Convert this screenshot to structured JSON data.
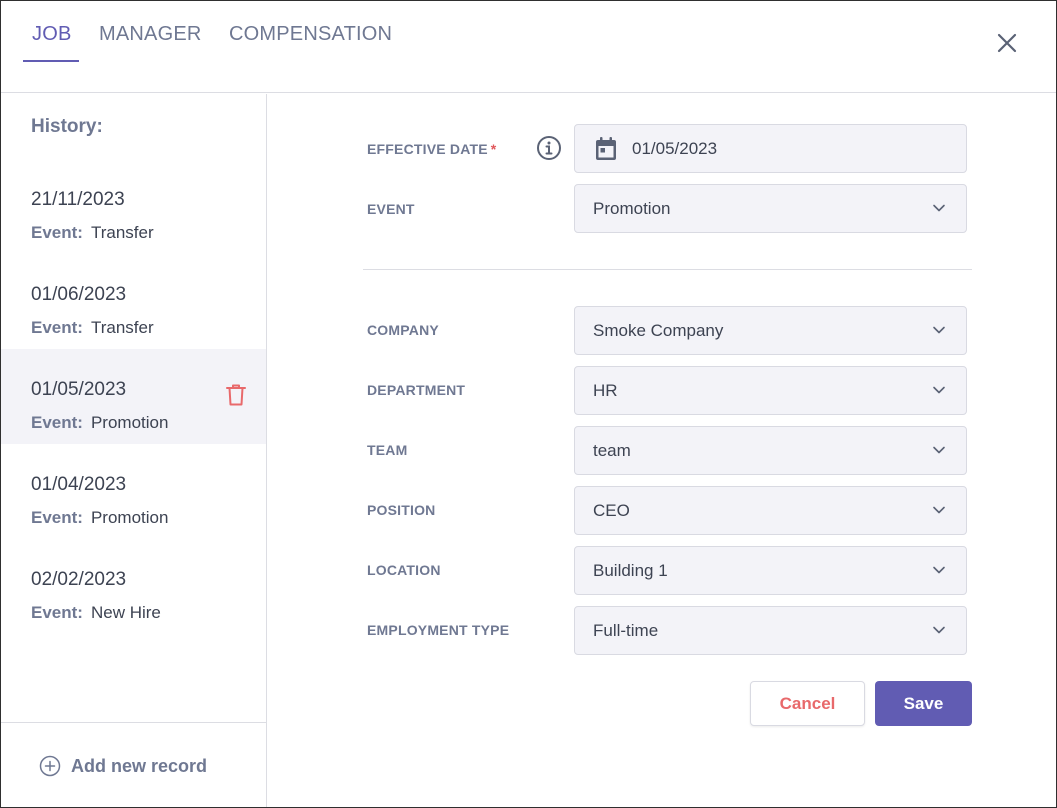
{
  "tabs": [
    {
      "label": "JOB",
      "active": true
    },
    {
      "label": "MANAGER",
      "active": false
    },
    {
      "label": "COMPENSATION",
      "active": false
    }
  ],
  "sidebar": {
    "title": "History:",
    "event_label": "Event:",
    "items": [
      {
        "date": "21/11/2023",
        "event": "Transfer"
      },
      {
        "date": "01/06/2023",
        "event": "Transfer"
      },
      {
        "date": "01/05/2023",
        "event": "Promotion",
        "selected": true
      },
      {
        "date": "01/04/2023",
        "event": "Promotion"
      },
      {
        "date": "02/02/2023",
        "event": "New Hire"
      }
    ],
    "add_record_label": "Add new record"
  },
  "form": {
    "effective_date": {
      "label": "EFFECTIVE DATE",
      "required_mark": "*",
      "value": "01/05/2023"
    },
    "event": {
      "label": "EVENT",
      "value": "Promotion"
    },
    "company": {
      "label": "COMPANY",
      "value": "Smoke Company"
    },
    "department": {
      "label": "DEPARTMENT",
      "value": "HR"
    },
    "team": {
      "label": "TEAM",
      "value": "team"
    },
    "position": {
      "label": "POSITION",
      "value": "CEO"
    },
    "location": {
      "label": "LOCATION",
      "value": "Building 1"
    },
    "employment_type": {
      "label": "EMPLOYMENT TYPE",
      "value": "Full-time"
    }
  },
  "actions": {
    "cancel_label": "Cancel",
    "save_label": "Save"
  },
  "colors": {
    "accent": "#615cb3",
    "danger": "#e8696b",
    "field_bg": "#f3f3f8",
    "muted_text": "#6f7892"
  },
  "icons": [
    "close-icon",
    "trash-icon",
    "add-circle-icon",
    "info-icon",
    "calendar-icon",
    "chevron-down-icon"
  ]
}
